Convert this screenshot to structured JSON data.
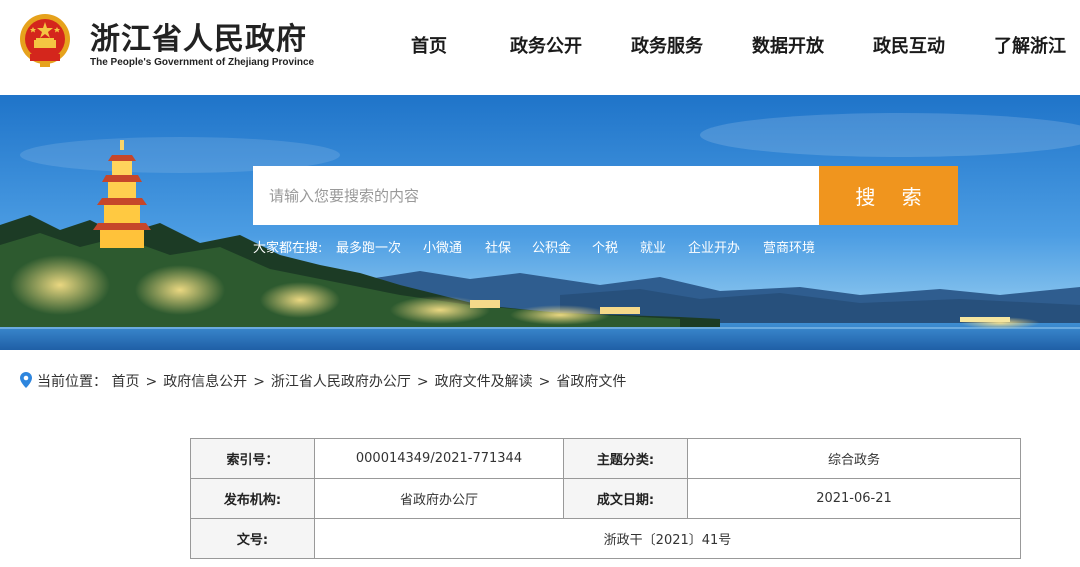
{
  "header": {
    "title": "浙江省人民政府",
    "subtitle": "The People's Government of Zhejiang Province",
    "emblem_icon": "national-emblem-icon"
  },
  "nav": {
    "items": [
      {
        "label": "首页"
      },
      {
        "label": "政务公开"
      },
      {
        "label": "政务服务"
      },
      {
        "label": "数据开放"
      },
      {
        "label": "政民互动"
      },
      {
        "label": "了解浙江"
      }
    ]
  },
  "search": {
    "placeholder": "请输入您要搜索的内容",
    "button_label": "搜 索",
    "hot_label": "大家都在搜:",
    "hot_links": [
      "最多跑一次",
      "小微通",
      "社保",
      "公积金",
      "个税",
      "就业",
      "企业开办",
      "营商环境"
    ]
  },
  "breadcrumb": {
    "prefix": "当前位置：",
    "items": [
      "首页",
      "政府信息公开",
      "浙江省人民政府办公厅",
      "政府文件及解读",
      "省政府文件"
    ],
    "separator": ">"
  },
  "info": {
    "index_label": "索引号：",
    "index_value": "000014349/2021-771344",
    "topic_label": "主题分类:",
    "topic_value": "综合政务",
    "issuer_label": "发布机构:",
    "issuer_value": "省政府办公厅",
    "date_label": "成文日期:",
    "date_value": "2021-06-21",
    "doc_label": "文号:",
    "doc_value": "浙政干〔2021〕41号"
  },
  "colors": {
    "search_button": "#f0951e",
    "sky_top": "#1f74c9",
    "nav_text": "#1a1a1a"
  }
}
